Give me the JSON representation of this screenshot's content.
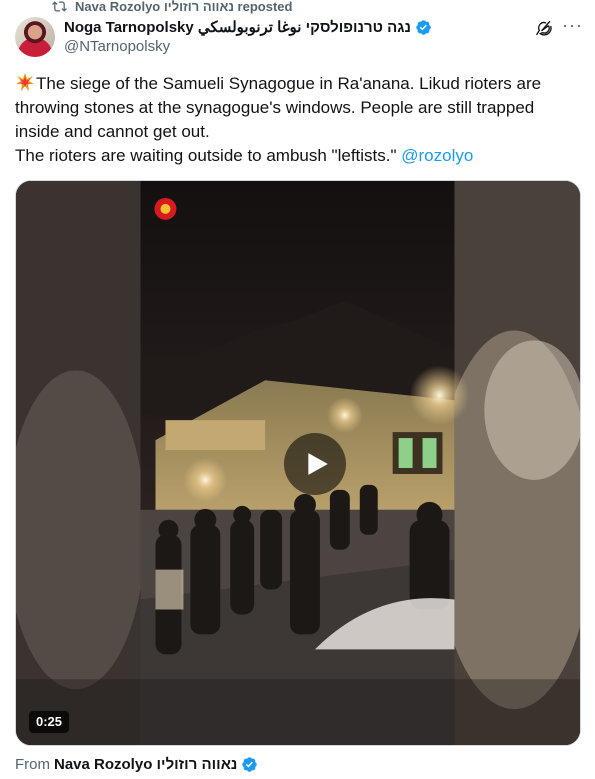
{
  "repost": {
    "icon": "repost-icon",
    "text": "Nava Rozolyo נאווה רוזוליו reposted"
  },
  "author": {
    "display_name": "Noga Tarnopolsky נגה טרנופולסקי نوغا ترنوبولسكي",
    "handle": "@NTarnopolsky",
    "verified": true,
    "verified_color": "#1d9bf0"
  },
  "actions": {
    "grok_icon": "grok-icon",
    "more_label": "···"
  },
  "tweet": {
    "emoji": "collision-emoji",
    "line1": "The siege of the Samueli Synagogue in Ra'anana. Likud rioters are",
    "line2": "throwing stones at the synagogue's windows. People are still trapped",
    "line3": "inside and cannot get out.",
    "line4": "The rioters are waiting outside to ambush \"leftists.\"",
    "mention": "@rozolyo",
    "mention_color": "#1d9bf0"
  },
  "media": {
    "type": "video",
    "play_icon": "play-icon",
    "duration": "0:25"
  },
  "source": {
    "prefix": "From",
    "name": "Nava Rozolyo נאווה רוזוליו",
    "verified": true
  }
}
